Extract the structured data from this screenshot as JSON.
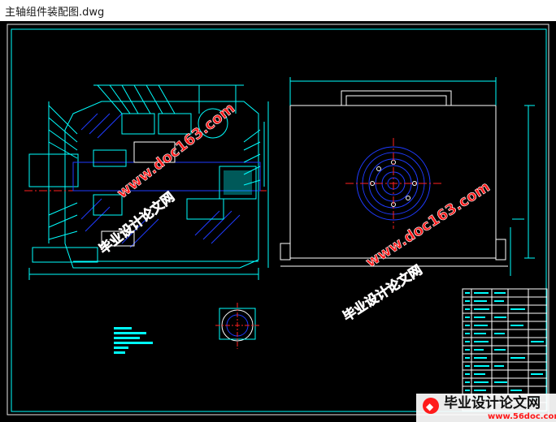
{
  "window": {
    "title": "主轴组件装配图.dwg"
  },
  "watermarks": {
    "site_url_1": "www.doc163.com",
    "site_name_1": "毕业设计论文网",
    "site_url_2": "www.doc163.com",
    "site_name_2": "毕业设计论文网",
    "footer_name": "毕业设计论文网",
    "footer_url": "www.56doc.com"
  },
  "colors": {
    "canvas_bg": "#000000",
    "cad_cyan": "#00ffff",
    "cad_blue": "#1f3bff",
    "cad_white": "#ffffff",
    "cad_red": "#ff2020",
    "cad_magenta": "#ff40ff",
    "watermark_red": "#ff1a1a"
  }
}
